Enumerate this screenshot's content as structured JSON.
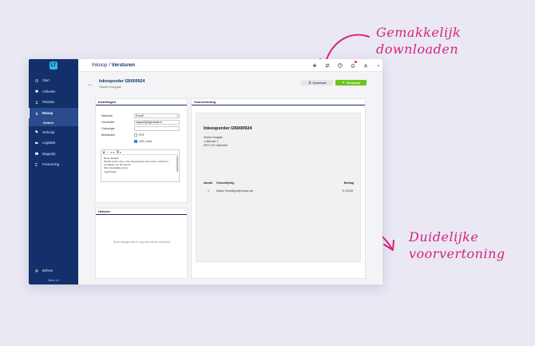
{
  "annotations": {
    "top": [
      "Gemakkelijk",
      "downloaden"
    ],
    "bottom": [
      "Duidelijke",
      "voorvertoning"
    ]
  },
  "sidebar": {
    "logo": "LT",
    "items": [
      {
        "label": "Start",
        "icon": "clock-icon"
      },
      {
        "label": "Artikelen",
        "icon": "box-icon"
      },
      {
        "label": "Relaties",
        "icon": "users-icon"
      },
      {
        "label": "Inkoop",
        "icon": "download-icon"
      },
      {
        "label": "Verkoop",
        "icon": "tag-icon"
      },
      {
        "label": "Logistiek",
        "icon": "truck-icon"
      },
      {
        "label": "Magazijn",
        "icon": "warehouse-icon"
      },
      {
        "label": "Facturering",
        "icon": "money-icon"
      }
    ],
    "sub_item": "Orders",
    "bottom_item": "Beheer",
    "week": "Week 12"
  },
  "topbar": {
    "crumb_parent": "Inkoop",
    "crumb_sep": " / ",
    "crumb_current": "Versturen"
  },
  "header": {
    "title": "Inkooporder I26000924",
    "subtitle": "Hunter Douglas",
    "download_label": "Download",
    "send_label": "Versturen"
  },
  "settings": {
    "title": "Instellingen",
    "method_label": "Methode",
    "method_value": "E-mail",
    "sender_label": "Verzender",
    "sender_value": "support@logictrade.nl",
    "receiver_label": "Ontvanger",
    "files_label": "Bestanden",
    "pdf_label": "PDF",
    "url_label": "URL (.xml)",
    "editor_toolbar": [
      "B",
      "I",
      "≡ ▾",
      "≣ ▾"
    ],
    "editor_lines": [
      "Beste Relatie,",
      "Hierbij sturen wij u onze inkooporder, deze kunt u vinden in",
      "de bijlage van dit bericht.",
      "Met vriendelijke groet,",
      "LogicTrade"
    ]
  },
  "history": {
    "title": "Historie",
    "empty": "Deze inkooporder is nog niet eerder verstuurd."
  },
  "preview": {
    "title": "Voorvertoning",
    "doc_title": "Inkooporder I26000924",
    "address": [
      "Hunter Douglas",
      "'s-Meester 1",
      "8070 CH Oldemarkt"
    ],
    "columns": [
      "Aantal",
      "Omschrijving",
      "Bedrag"
    ],
    "row": [
      "1",
      "Nubus Paneelgordijn losse rail",
      "€ 123,00"
    ]
  }
}
